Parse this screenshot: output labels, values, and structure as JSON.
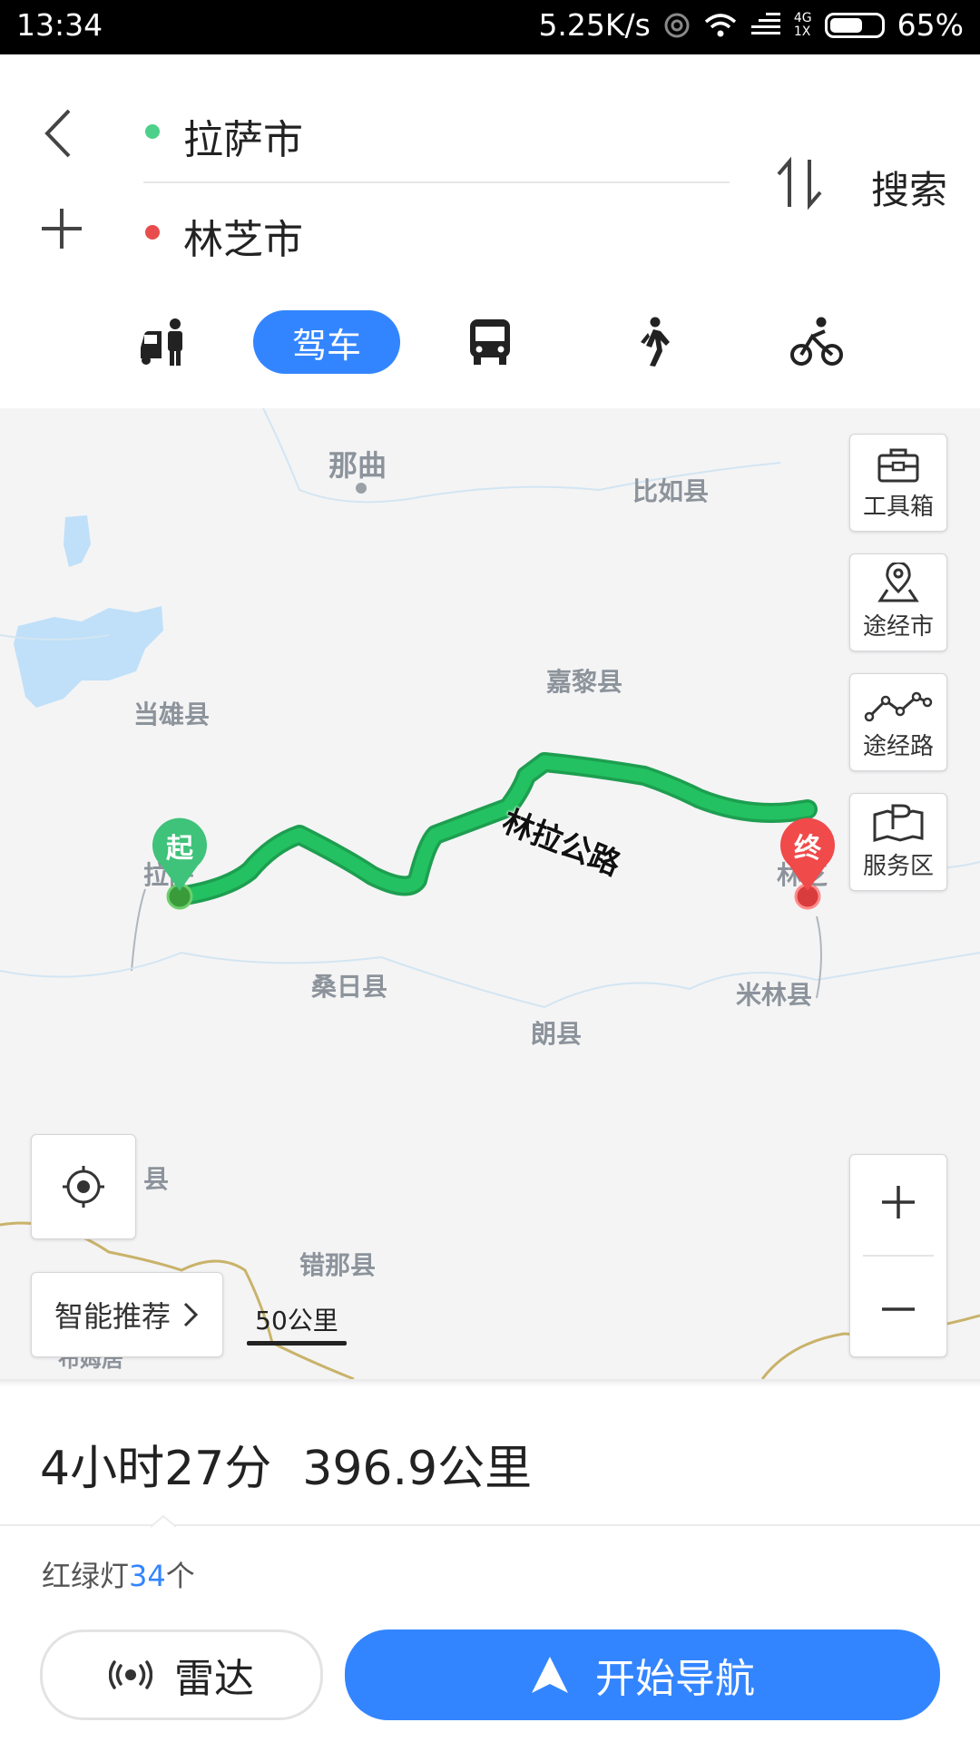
{
  "status_bar": {
    "time": "13:34",
    "net_speed": "5.25K/s",
    "network_type": "4G",
    "sim": "1X",
    "battery": "65%",
    "battery_level": 0.65
  },
  "route_input": {
    "origin": "拉萨市",
    "destination": "林芝市",
    "search_label": "搜索",
    "origin_color": "#4cd08a",
    "destination_color": "#e84c4c"
  },
  "modes": [
    {
      "name": "taxi",
      "label": ""
    },
    {
      "name": "drive",
      "label": "驾车"
    },
    {
      "name": "bus",
      "label": ""
    },
    {
      "name": "walk",
      "label": ""
    },
    {
      "name": "bike",
      "label": ""
    }
  ],
  "map": {
    "labels": {
      "naqu": "那曲",
      "biru": "比如县",
      "damxung": "当雄县",
      "jiali": "嘉黎县",
      "sangri": "桑日县",
      "langxian": "朗县",
      "milin": "米林县",
      "cuona": "错那县",
      "county_partial": "县",
      "bumu": "布姆居",
      "lhasa_partial": "拉萨",
      "linzhi_partial": "林芝"
    },
    "road_name": "林拉公路",
    "start_marker": "起",
    "end_marker": "终",
    "scale": "50公里",
    "tools": {
      "toolbox": "工具箱",
      "via_city": "途经市",
      "via_road": "途经路",
      "service_area": "服务区"
    },
    "smart_recommend": "智能推荐",
    "accent_green": "#23c161",
    "accent_red": "#f04a4a"
  },
  "summary": {
    "duration": "4小时27分",
    "distance": "396.9公里",
    "lights_prefix": "红绿灯",
    "lights_count": "34",
    "lights_suffix": "个"
  },
  "actions": {
    "radar": "雷达",
    "start_nav": "开始导航",
    "primary_color": "#3385ff"
  }
}
